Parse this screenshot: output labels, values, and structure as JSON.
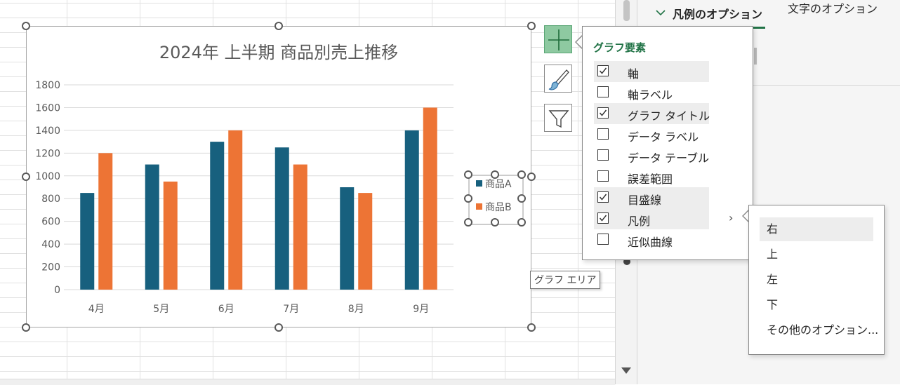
{
  "sheet": {},
  "side_pane": {
    "tab_legend": "凡例のオプション",
    "tab_text": "文字のオプション"
  },
  "chart": {
    "title": "2024年 上半期 商品別売上推移"
  },
  "chart_data": {
    "type": "bar",
    "title": "2024年 上半期 商品別売上推移",
    "categories": [
      "4月",
      "5月",
      "6月",
      "7月",
      "8月",
      "9月"
    ],
    "series": [
      {
        "name": "商品A",
        "values": [
          850,
          1100,
          1300,
          1250,
          900,
          1400
        ],
        "color": "#17607e"
      },
      {
        "name": "商品B",
        "values": [
          1200,
          950,
          1400,
          1100,
          850,
          1600
        ],
        "color": "#ed7435"
      }
    ],
    "yticks": [
      0,
      200,
      400,
      600,
      800,
      1000,
      1200,
      1400,
      1600,
      1800
    ],
    "ylim": [
      0,
      1800
    ],
    "grid": true,
    "legend_position": "right",
    "xlabel": "",
    "ylabel": ""
  },
  "tooltip": "グラフ エリア",
  "elements_panel": {
    "title": "グラフ要素",
    "items": [
      {
        "label": "軸",
        "checked": true
      },
      {
        "label": "軸ラベル",
        "checked": false
      },
      {
        "label": "グラフ タイトル",
        "checked": true
      },
      {
        "label": "データ ラベル",
        "checked": false
      },
      {
        "label": "データ テーブル",
        "checked": false
      },
      {
        "label": "誤差範囲",
        "checked": false
      },
      {
        "label": "目盛線",
        "checked": true
      },
      {
        "label": "凡例",
        "checked": true
      },
      {
        "label": "近似曲線",
        "checked": false
      }
    ],
    "chevron": "›"
  },
  "legend_submenu": {
    "items": [
      "右",
      "上",
      "左",
      "下",
      "その他のオプション..."
    ],
    "selected": "右"
  }
}
